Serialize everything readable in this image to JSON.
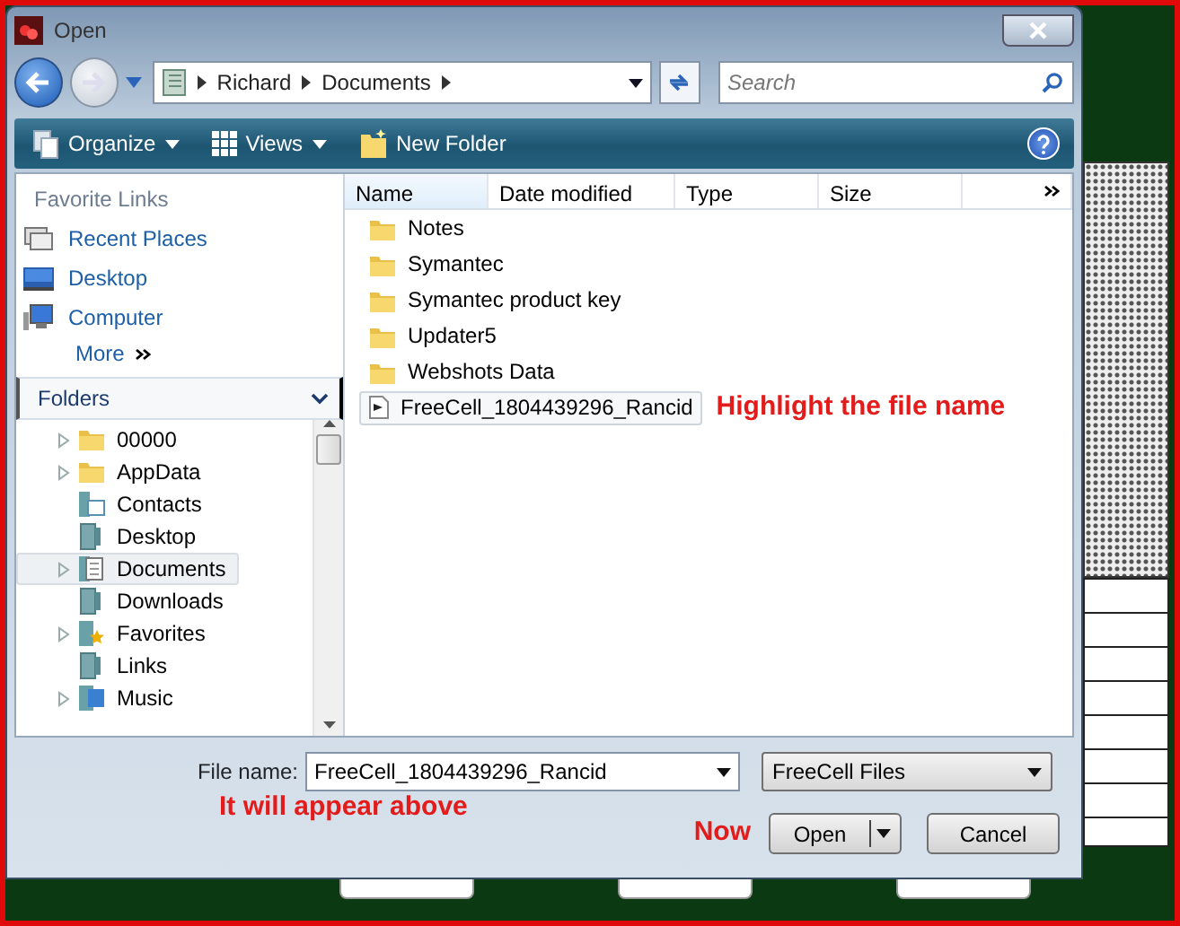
{
  "window": {
    "title": "Open"
  },
  "address_bar": {
    "path": [
      "Richard",
      "Documents"
    ],
    "search": {
      "placeholder": "Search"
    }
  },
  "toolbar": {
    "items": [
      {
        "label": "Organize",
        "kind": "organize"
      },
      {
        "label": "Views",
        "kind": "views"
      },
      {
        "label": "New Folder",
        "kind": "newfolder"
      }
    ]
  },
  "favorite_links": {
    "title": "Favorite Links",
    "items": [
      {
        "label": "Recent Places",
        "kind": "recent"
      },
      {
        "label": "Desktop",
        "kind": "desktop"
      },
      {
        "label": "Computer",
        "kind": "computer"
      }
    ],
    "more": "More"
  },
  "folders": {
    "title": "Folders",
    "expanded": true,
    "items": [
      {
        "label": "00000",
        "kind": "folder",
        "expandable": true,
        "selected": false
      },
      {
        "label": "AppData",
        "kind": "folder",
        "expandable": true,
        "selected": false
      },
      {
        "label": "Contacts",
        "kind": "contacts",
        "expandable": false,
        "selected": false
      },
      {
        "label": "Desktop",
        "kind": "special",
        "expandable": false,
        "selected": false
      },
      {
        "label": "Documents",
        "kind": "documents",
        "expandable": true,
        "selected": true
      },
      {
        "label": "Downloads",
        "kind": "special",
        "expandable": false,
        "selected": false
      },
      {
        "label": "Favorites",
        "kind": "favorites",
        "expandable": true,
        "selected": false
      },
      {
        "label": "Links",
        "kind": "special",
        "expandable": false,
        "selected": false
      },
      {
        "label": "Music",
        "kind": "music",
        "expandable": true,
        "selected": false
      }
    ]
  },
  "file_list": {
    "columns": [
      {
        "label": "Name",
        "sorted": true
      },
      {
        "label": "Date modified",
        "sorted": false
      },
      {
        "label": "Type",
        "sorted": false
      },
      {
        "label": "Size",
        "sorted": false
      }
    ],
    "rows": [
      {
        "name": "Notes",
        "kind": "folder",
        "selected": false
      },
      {
        "name": "Symantec",
        "kind": "folder",
        "selected": false
      },
      {
        "name": "Symantec product key",
        "kind": "folder",
        "selected": false
      },
      {
        "name": "Updater5",
        "kind": "folder",
        "selected": false
      },
      {
        "name": "Webshots Data",
        "kind": "folder",
        "selected": false
      },
      {
        "name": "FreeCell_1804439296_Rancid",
        "kind": "file",
        "selected": true
      }
    ]
  },
  "file_name": {
    "label": "File name:",
    "value": "FreeCell_1804439296_Rancid"
  },
  "file_type": {
    "value": "FreeCell Files"
  },
  "buttons": [
    {
      "label": "Open",
      "kind": "split"
    },
    {
      "label": "Cancel",
      "kind": "plain"
    }
  ],
  "annotations": [
    "Highlight the file name",
    "It will appear above",
    "Now"
  ]
}
